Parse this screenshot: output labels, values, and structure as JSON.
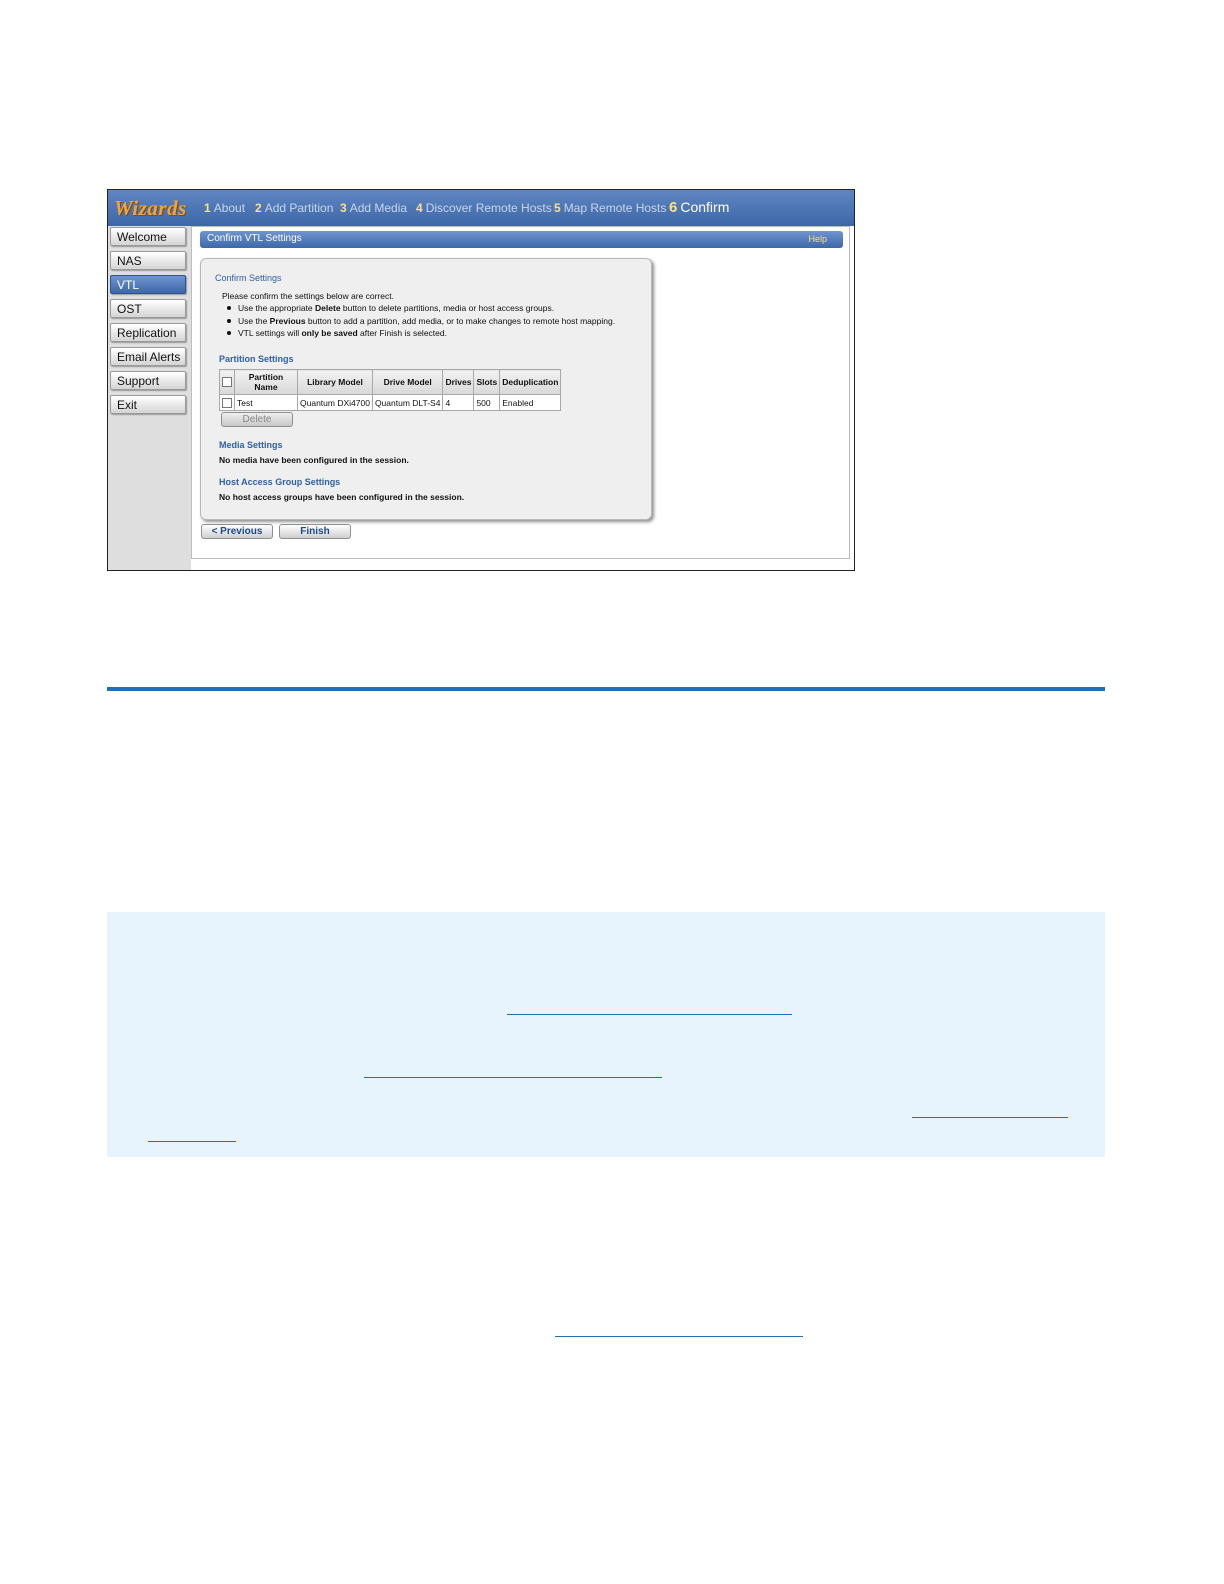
{
  "wizard": {
    "title": "Wizards",
    "steps": [
      {
        "num": "1",
        "label": "About"
      },
      {
        "num": "2",
        "label": "Add Partition"
      },
      {
        "num": "3",
        "label": "Add Media"
      },
      {
        "num": "4",
        "label": "Discover Remote Hosts"
      },
      {
        "num": "5",
        "label": "Map Remote Hosts"
      },
      {
        "num": "6",
        "label": "Confirm"
      }
    ],
    "active_step": "6"
  },
  "nav": {
    "items": [
      {
        "label": "Welcome"
      },
      {
        "label": "NAS"
      },
      {
        "label": "VTL"
      },
      {
        "label": "OST"
      },
      {
        "label": "Replication"
      },
      {
        "label": "Email Alerts"
      },
      {
        "label": "Support"
      },
      {
        "label": "Exit"
      }
    ],
    "active": "VTL"
  },
  "content": {
    "header_title": "Confirm VTL Settings",
    "help_label": "Help",
    "confirm_title": "Confirm Settings",
    "intro": "Please confirm the settings below are correct.",
    "bullets": [
      {
        "pre": "Use the appropriate ",
        "bold": "Delete",
        "post": " button to delete partitions, media or host access groups."
      },
      {
        "pre": "Use the ",
        "bold": "Previous",
        "post": " button to add a partition, add media, or to make changes to remote host mapping."
      },
      {
        "pre": "VTL settings will ",
        "bold": "only be saved",
        "post": " after Finish is selected."
      }
    ],
    "partition_title": "Partition Settings",
    "table": {
      "headers": [
        "Partition Name",
        "Library Model",
        "Drive Model",
        "Drives",
        "Slots",
        "Deduplication"
      ],
      "rows": [
        [
          "Test",
          "Quantum DXi4700",
          "Quantum DLT-S4",
          "4",
          "500",
          "Enabled"
        ]
      ]
    },
    "delete_label": "Delete",
    "media_title": "Media Settings",
    "media_text": "No media have been configured in the session.",
    "host_title": "Host Access Group Settings",
    "host_text": "No host access groups have been configured in the session.",
    "previous_label": "< Previous",
    "finish_label": "Finish"
  },
  "colors": {
    "accent_blue": "#1f6fb5",
    "note_bg": "#e7f3fd",
    "wizard_bar": "#4a72b0",
    "wizard_title": "#f2a43a"
  }
}
